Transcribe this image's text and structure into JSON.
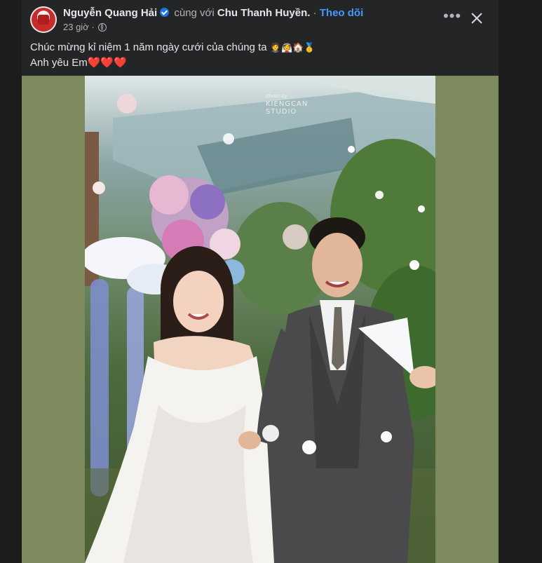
{
  "post": {
    "author": "Nguyễn Quang Hải",
    "with_text": "cùng với",
    "tagged": "Chu Thanh Huyền.",
    "separator": "·",
    "follow_label": "Theo dõi",
    "timestamp": "23 giờ",
    "more_label": "•••",
    "caption_line1": "Chúc mừng kỉ niệm 1 năm ngày cưới của chúng ta",
    "caption_line1_emojis": "🤵👰🏠🥇",
    "caption_line2": "Anh yêu Em",
    "caption_line2_emojis": "❤️❤️❤️",
    "icons": {
      "verified": "verified-badge-icon",
      "privacy": "globe-icon",
      "more": "more-options-icon",
      "close": "close-icon"
    }
  },
  "photo": {
    "watermark_small": "photo by",
    "watermark_line1": "KIENGCAN",
    "watermark_line2": "STUDIO"
  },
  "colors": {
    "background": "#1c1c1d",
    "card": "#242526",
    "follow_link": "#4599ff",
    "verified": "#1b74e4",
    "photo_backdrop": "#7c8a5e"
  }
}
